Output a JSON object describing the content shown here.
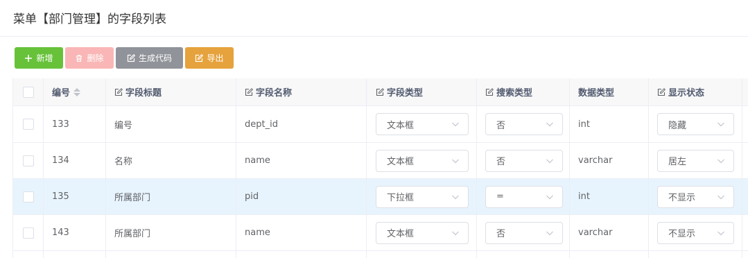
{
  "page": {
    "title": "菜单【部门管理】的字段列表"
  },
  "toolbar": {
    "add_label": "新增",
    "delete_label": "删除",
    "generate_label": "生成代码",
    "export_label": "导出"
  },
  "colors": {
    "add": "#67c23a",
    "delete": "#fab6b6",
    "generate": "#909399",
    "export": "#e6a23c",
    "selected_row": "#e8f4fd"
  },
  "table": {
    "columns": {
      "id": "编号",
      "field_title": "字段标题",
      "field_name": "字段名称",
      "field_type": "字段类型",
      "search_type": "搜索类型",
      "data_type": "数据类型",
      "display_status": "显示状态"
    },
    "rows": [
      {
        "id": "133",
        "field_title": "编号",
        "field_name": "dept_id",
        "field_type": "文本框",
        "search_type": "否",
        "data_type": "int",
        "display_status": "隐藏"
      },
      {
        "id": "134",
        "field_title": "名称",
        "field_name": "name",
        "field_type": "文本框",
        "search_type": "否",
        "data_type": "varchar",
        "display_status": "居左"
      },
      {
        "id": "135",
        "field_title": "所属部门",
        "field_name": "pid",
        "field_type": "下拉框",
        "search_type": "=",
        "data_type": "int",
        "display_status": "不显示"
      },
      {
        "id": "143",
        "field_title": "所属部门",
        "field_name": "name",
        "field_type": "文本框",
        "search_type": "否",
        "data_type": "varchar",
        "display_status": "不显示"
      }
    ]
  }
}
